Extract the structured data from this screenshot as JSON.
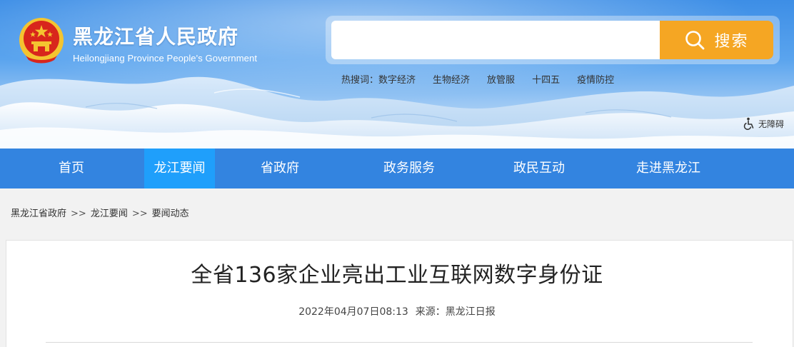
{
  "header": {
    "site_title": "黑龙江省人民政府",
    "site_subtitle": "Heilongjiang Province People's Government",
    "search": {
      "placeholder": "",
      "button_label": "搜索"
    },
    "hot_search": {
      "label": "热搜词：",
      "terms": [
        "数字经济",
        "生物经济",
        "放管服",
        "十四五",
        "疫情防控"
      ]
    },
    "accessibility_label": "无障碍"
  },
  "nav": {
    "items": [
      {
        "label": "首页"
      },
      {
        "label": "龙江要闻",
        "active": true
      },
      {
        "label": "省政府"
      },
      {
        "label": "政务服务"
      },
      {
        "label": "政民互动"
      },
      {
        "label": "走进黑龙江"
      }
    ]
  },
  "breadcrumb": {
    "items": [
      "黑龙江省政府",
      "龙江要闻",
      "要闻动态"
    ],
    "separator": ">>"
  },
  "article": {
    "title": "全省136家企业亮出工业互联网数字身份证",
    "datetime": "2022年04月07日08:13",
    "source": "来源：黑龙江日报"
  },
  "colors": {
    "nav_bg": "#3384e0",
    "nav_active": "#1f9ffb",
    "search_button": "#f5a623",
    "emblem_red": "#d8261c",
    "emblem_gold": "#f4c430"
  },
  "icons": {
    "emblem": "national-emblem-icon",
    "search": "search-icon",
    "accessibility": "wheelchair-icon"
  }
}
